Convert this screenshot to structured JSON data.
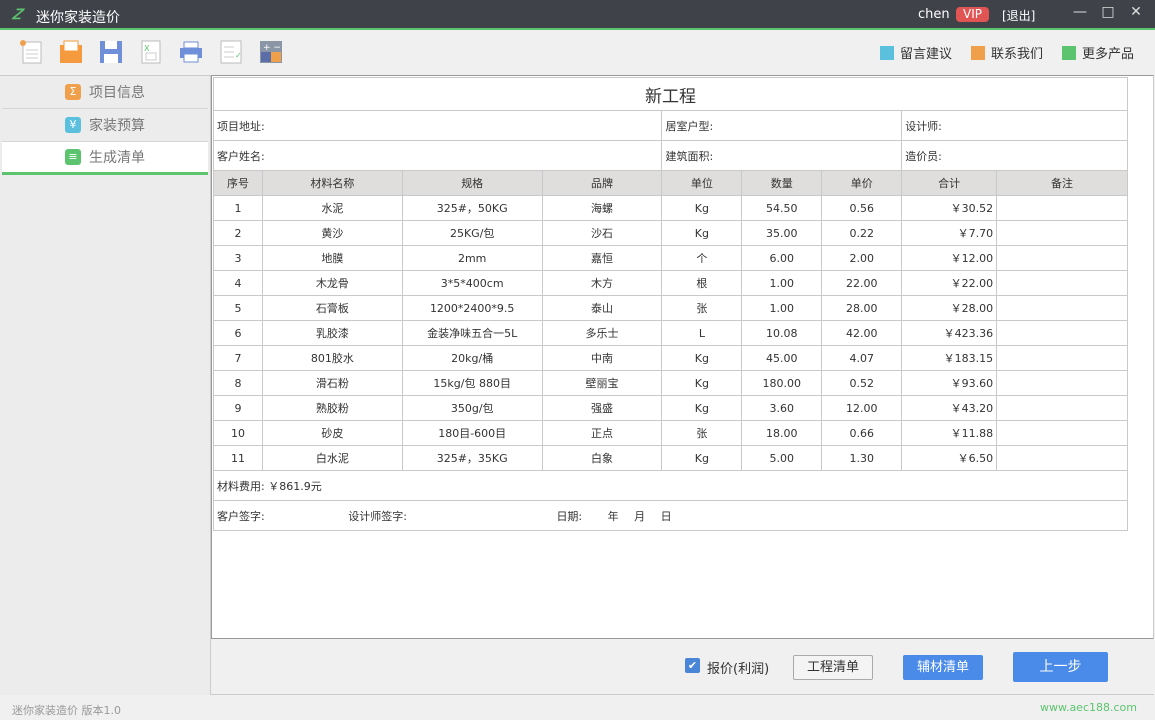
{
  "window": {
    "logo": "𝑍",
    "title": "迷你家装造价",
    "user": "chen",
    "vip": "VIP",
    "logout": "[退出]",
    "minimize": "—",
    "maximize": "□",
    "close": "✕"
  },
  "toolbar": {
    "icons": [
      "new-file-icon",
      "open-folder-icon",
      "save-icon",
      "excel-export-icon",
      "print-icon",
      "checklist-icon",
      "calculator-icon"
    ],
    "links": [
      {
        "label": "留言建议",
        "color": "#5bc0de"
      },
      {
        "label": "联系我们",
        "color": "#f0a04b"
      },
      {
        "label": "更多产品",
        "color": "#5cc46e"
      }
    ]
  },
  "sidebar": {
    "items": [
      {
        "label": "项目信息",
        "glyph": "Σ",
        "color": "#f0a04b"
      },
      {
        "label": "家装预算",
        "glyph": "¥",
        "color": "#5bc0de"
      },
      {
        "label": "生成清单",
        "glyph": "≡",
        "color": "#5cc46e"
      }
    ]
  },
  "document": {
    "title": "新工程",
    "info": [
      [
        "项目地址:",
        "居室户型:",
        "设计师:"
      ],
      [
        "客户姓名:",
        "建筑面积:",
        "造价员:"
      ]
    ],
    "headers": [
      "序号",
      "材料名称",
      "规格",
      "品牌",
      "单位",
      "数量",
      "单价",
      "合计",
      "备注"
    ],
    "rows": [
      [
        "1",
        "水泥",
        "325#，50KG",
        "海螺",
        "Kg",
        "54.50",
        "0.56",
        "￥30.52",
        ""
      ],
      [
        "2",
        "黄沙",
        "25KG/包",
        "沙石",
        "Kg",
        "35.00",
        "0.22",
        "￥7.70",
        ""
      ],
      [
        "3",
        "地膜",
        "2mm",
        "嘉恒",
        "个",
        "6.00",
        "2.00",
        "￥12.00",
        ""
      ],
      [
        "4",
        "木龙骨",
        "3*5*400cm",
        "木方",
        "根",
        "1.00",
        "22.00",
        "￥22.00",
        ""
      ],
      [
        "5",
        "石膏板",
        "1200*2400*9.5",
        "泰山",
        "张",
        "1.00",
        "28.00",
        "￥28.00",
        ""
      ],
      [
        "6",
        "乳胶漆",
        "金装净味五合一5L",
        "多乐士",
        "L",
        "10.08",
        "42.00",
        "￥423.36",
        ""
      ],
      [
        "7",
        "801胶水",
        "20kg/桶",
        "中南",
        "Kg",
        "45.00",
        "4.07",
        "￥183.15",
        ""
      ],
      [
        "8",
        "滑石粉",
        "15kg/包 880目",
        "壁丽宝",
        "Kg",
        "180.00",
        "0.52",
        "￥93.60",
        ""
      ],
      [
        "9",
        "熟胶粉",
        "350g/包",
        "强盛",
        "Kg",
        "3.60",
        "12.00",
        "￥43.20",
        ""
      ],
      [
        "10",
        "砂皮",
        "180目-600目",
        "正点",
        "张",
        "18.00",
        "0.66",
        "￥11.88",
        ""
      ],
      [
        "11",
        "白水泥",
        "325#，35KG",
        "白象",
        "Kg",
        "5.00",
        "1.30",
        "￥6.50",
        ""
      ]
    ],
    "material_fee": "材料费用: ￥861.9元",
    "signature": {
      "customer": "客户签字:",
      "designer": "设计师签字:",
      "date": "日期:",
      "year": "年",
      "month": "月",
      "day": "日"
    }
  },
  "bottom": {
    "checkbox_label": "报价(利润)",
    "checked": true,
    "btn_project": "工程清单",
    "btn_aux": "辅材清单",
    "btn_prev": "上一步"
  },
  "status": {
    "version": "迷你家装造价  版本1.0",
    "url": "www.aec188.com"
  }
}
